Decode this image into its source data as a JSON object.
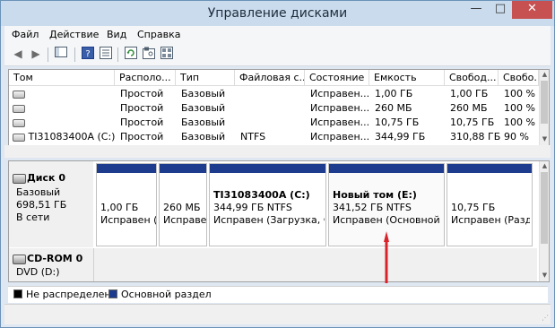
{
  "window": {
    "title": "Управление дисками"
  },
  "menu": [
    "Файл",
    "Действие",
    "Вид",
    "Справка"
  ],
  "toolbar": {
    "icons": [
      "back-icon",
      "forward-icon",
      "console-tree-icon",
      "help-icon",
      "properties-icon",
      "refresh-icon",
      "settings-icon",
      "view-icon"
    ]
  },
  "volumes": {
    "columns": [
      "Том",
      "Располо...",
      "Тип",
      "Файловая с...",
      "Состояние",
      "Емкость",
      "Свобод...",
      "Свобо..."
    ],
    "rows": [
      [
        "",
        "Простой",
        "Базовый",
        "",
        "Исправен...",
        "1,00 ГБ",
        "1,00 ГБ",
        "100 %"
      ],
      [
        "",
        "Простой",
        "Базовый",
        "",
        "Исправен...",
        "260 МБ",
        "260 МБ",
        "100 %"
      ],
      [
        "",
        "Простой",
        "Базовый",
        "",
        "Исправен...",
        "10,75 ГБ",
        "10,75 ГБ",
        "100 %"
      ],
      [
        "TI31083400A (C:)",
        "Простой",
        "Базовый",
        "NTFS",
        "Исправен...",
        "344,99 ГБ",
        "310,88 ГБ",
        "90 %"
      ]
    ]
  },
  "disk0": {
    "name": "Диск 0",
    "type": "Базовый",
    "size": "698,51 ГБ",
    "status": "В сети",
    "partitions": [
      {
        "name": "",
        "size": "1,00 ГБ",
        "status": "Исправен ("
      },
      {
        "name": "",
        "size": "260 МБ",
        "status": "Исправен"
      },
      {
        "name": "TI31083400A  (C:)",
        "size": "344,99 ГБ NTFS",
        "status": "Исправен (Загрузка, Фа"
      },
      {
        "name": "Новый том  (E:)",
        "size": "341,52 ГБ NTFS",
        "status": "Исправен (Основной р"
      },
      {
        "name": "",
        "size": "10,75 ГБ",
        "status": "Исправен (Разде"
      }
    ]
  },
  "cdrom": {
    "name": "CD-ROM 0",
    "type": "DVD (D:)"
  },
  "legend": [
    {
      "label": "Не распределена",
      "color": "#000000"
    },
    {
      "label": "Основной раздел",
      "color": "#1d3c8d"
    }
  ],
  "colors": {
    "accent": "#1d3c8d",
    "arrow": "#d9232a",
    "close": "#c75050"
  }
}
